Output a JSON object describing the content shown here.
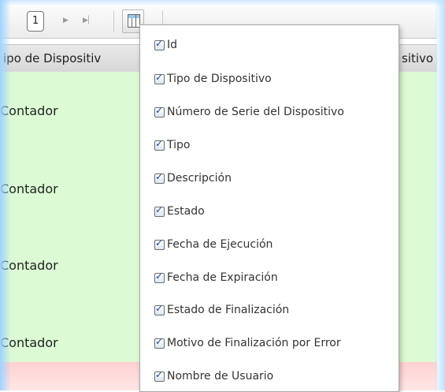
{
  "pager": {
    "current_page": "1",
    "next_icon": "next-page-icon",
    "last_icon": "last-page-icon",
    "columns_icon": "columns-icon"
  },
  "grid": {
    "headers": [
      "ipo de Dispositiv",
      "sitivo"
    ],
    "rows": [
      "Contador",
      "Contador",
      "Contador",
      "Contador"
    ]
  },
  "column_chooser": {
    "items": [
      {
        "label": "Id",
        "checked": true
      },
      {
        "label": "Tipo de Dispositivo",
        "checked": true
      },
      {
        "label": "Número de Serie del Dispositivo",
        "checked": true
      },
      {
        "label": "Tipo",
        "checked": true
      },
      {
        "label": "Descripción",
        "checked": true
      },
      {
        "label": "Estado",
        "checked": true
      },
      {
        "label": "Fecha de Ejecución",
        "checked": true
      },
      {
        "label": "Fecha de Expiración",
        "checked": true
      },
      {
        "label": "Estado de Finalización",
        "checked": true
      },
      {
        "label": "Motivo de Finalización por Error",
        "checked": true
      },
      {
        "label": "Nombre de Usuario",
        "checked": true
      }
    ]
  },
  "colors": {
    "row_background": "#dcfbd4",
    "error_row_background": "#ffd0d0",
    "header_background": "#dcdcdc",
    "accent": "#1f3f8e"
  }
}
